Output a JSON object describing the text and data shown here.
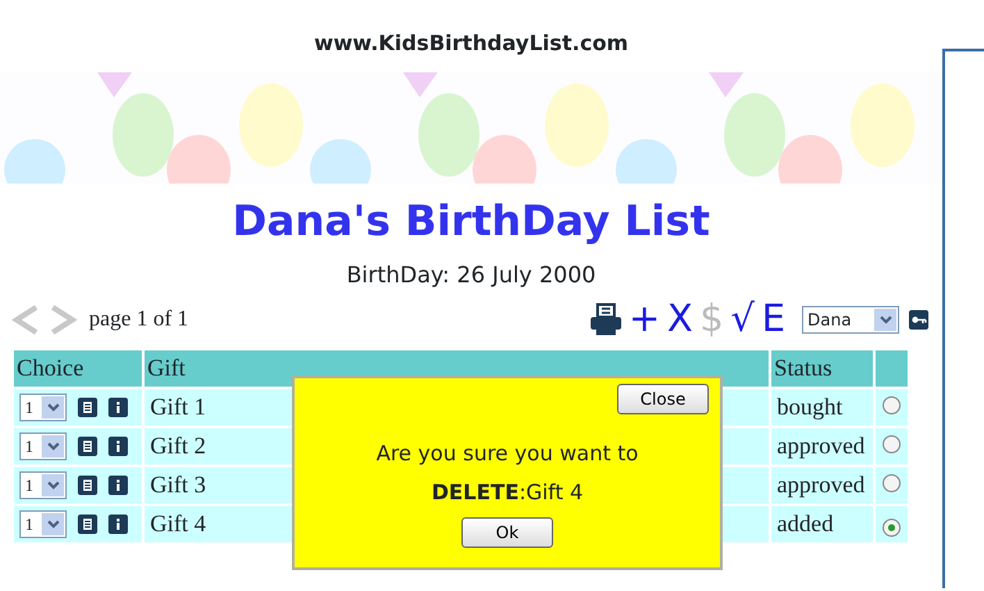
{
  "site": "www.KidsBirthdayList.com",
  "title": "Dana's BirthDay List",
  "birthday": "BirthDay: 26 July 2000",
  "pager": {
    "text": "page 1 of 1"
  },
  "toolbar": [
    {
      "kind": "print"
    },
    {
      "kind": "glyph",
      "label": "+",
      "disabled": false
    },
    {
      "kind": "glyph",
      "label": "X",
      "disabled": false
    },
    {
      "kind": "glyph",
      "label": "$",
      "disabled": true
    },
    {
      "kind": "glyph",
      "label": "√",
      "disabled": false
    },
    {
      "kind": "glyph",
      "label": "E",
      "disabled": false
    }
  ],
  "user_select": {
    "value": "Dana"
  },
  "table": {
    "columns": [
      "Choice",
      "Gift",
      "Status"
    ],
    "rows": [
      {
        "choice": "1",
        "gift": "Gift 1",
        "status": "bought",
        "selected": false
      },
      {
        "choice": "1",
        "gift": "Gift 2",
        "status": "approved",
        "selected": false
      },
      {
        "choice": "1",
        "gift": "Gift 3",
        "status": "approved",
        "selected": false
      },
      {
        "choice": "1",
        "gift": "Gift 4",
        "status": "added",
        "selected": true
      }
    ]
  },
  "dialog": {
    "close": "Close",
    "message": "Are you sure you want to **DELETE**:Gift 4",
    "ok": "Ok"
  }
}
